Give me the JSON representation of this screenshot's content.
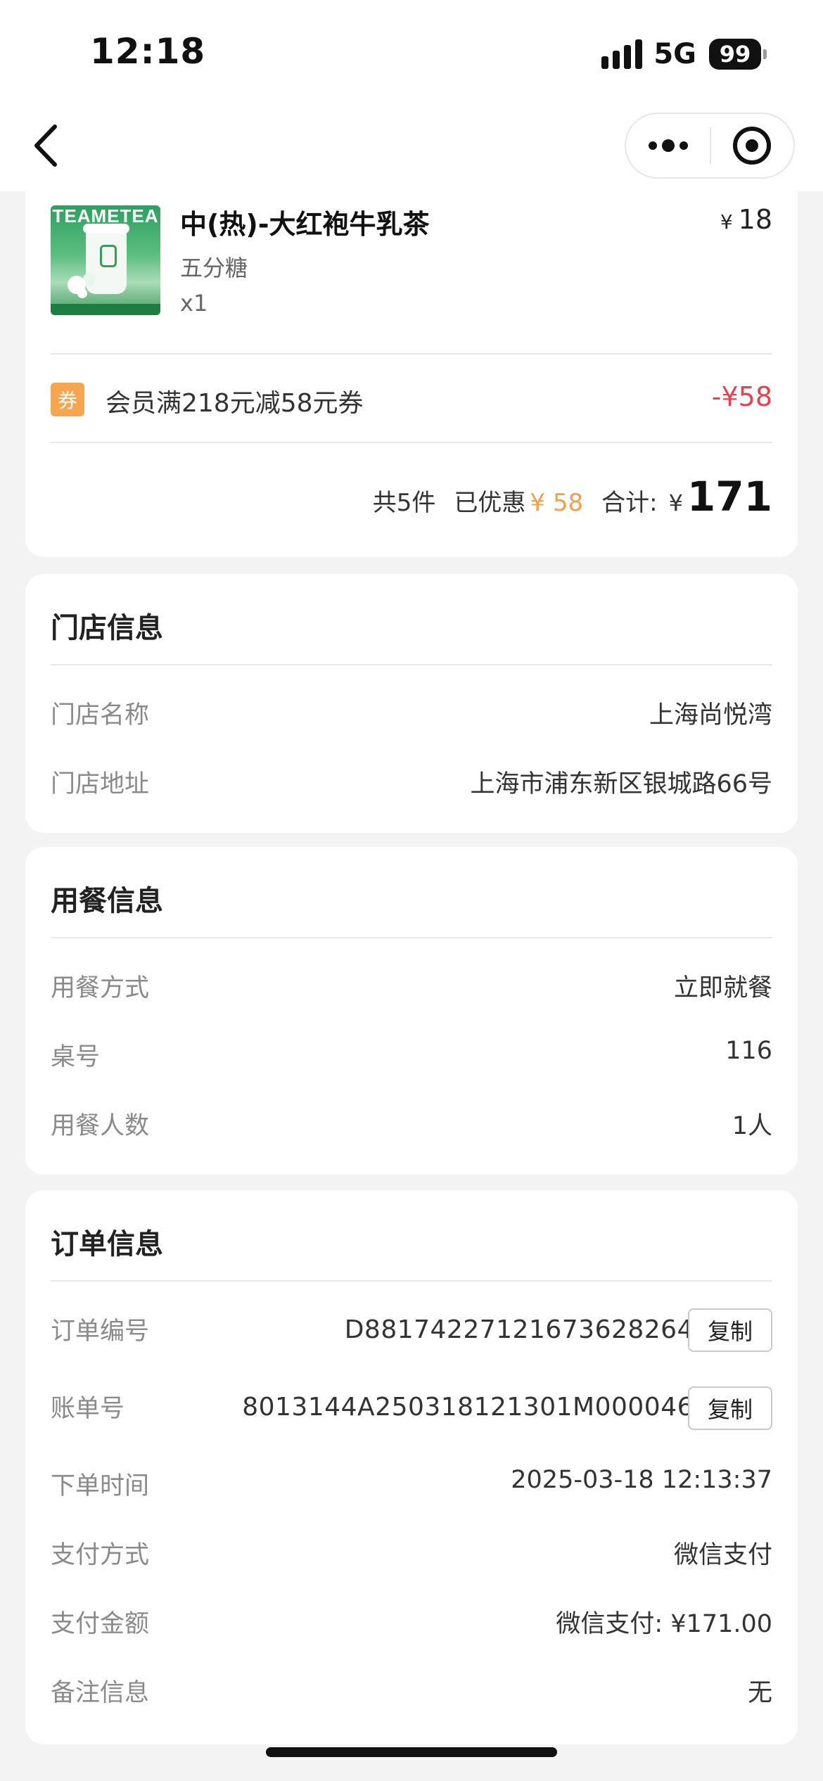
{
  "status_bar": {
    "time": "12:18",
    "network": "5G",
    "battery": "99"
  },
  "nav": {
    "back_icon": "chevron-left-icon",
    "more_icon": "more-dots-icon",
    "close_icon": "target-circle-icon"
  },
  "order_item": {
    "image_brand": "TEAMETEA",
    "name": "中(热)-大红袍牛乳茶",
    "price_symbol": "¥",
    "price": "18",
    "spec": "五分糖",
    "quantity": "x1"
  },
  "coupon": {
    "badge": "券",
    "text": "会员满218元减58元券",
    "amount": "-¥58"
  },
  "summary": {
    "count_text": "共5件",
    "saved_label": "已优惠",
    "saved_value": "¥ 58",
    "total_label": "合计:",
    "total_symbol": "¥",
    "total_amount": "171"
  },
  "store_info": {
    "title": "门店信息",
    "rows": [
      {
        "label": "门店名称",
        "value": "上海尚悦湾"
      },
      {
        "label": "门店地址",
        "value": "上海市浦东新区银城路66号"
      }
    ]
  },
  "dining_info": {
    "title": "用餐信息",
    "rows": [
      {
        "label": "用餐方式",
        "value": "立即就餐"
      },
      {
        "label": "桌号",
        "value": "116"
      },
      {
        "label": "用餐人数",
        "value": "1人"
      }
    ]
  },
  "order_info": {
    "title": "订单信息",
    "copy_label": "复制",
    "rows": [
      {
        "label": "订单编号",
        "value": "D88174227121673628264"
      },
      {
        "label": "账单号",
        "value": "8013144A250318121301M000046"
      },
      {
        "label": "下单时间",
        "value": "2025-03-18 12:13:37"
      },
      {
        "label": "支付方式",
        "value": "微信支付"
      },
      {
        "label": "支付金额",
        "value": "微信支付: ¥171.00"
      },
      {
        "label": "备注信息",
        "value": "无"
      }
    ]
  },
  "colors": {
    "background": "#f3f3f3",
    "card": "#ffffff",
    "discount_red": "#e04452",
    "saved_orange": "#f0a04a",
    "coupon_badge": "#f5a64f"
  }
}
